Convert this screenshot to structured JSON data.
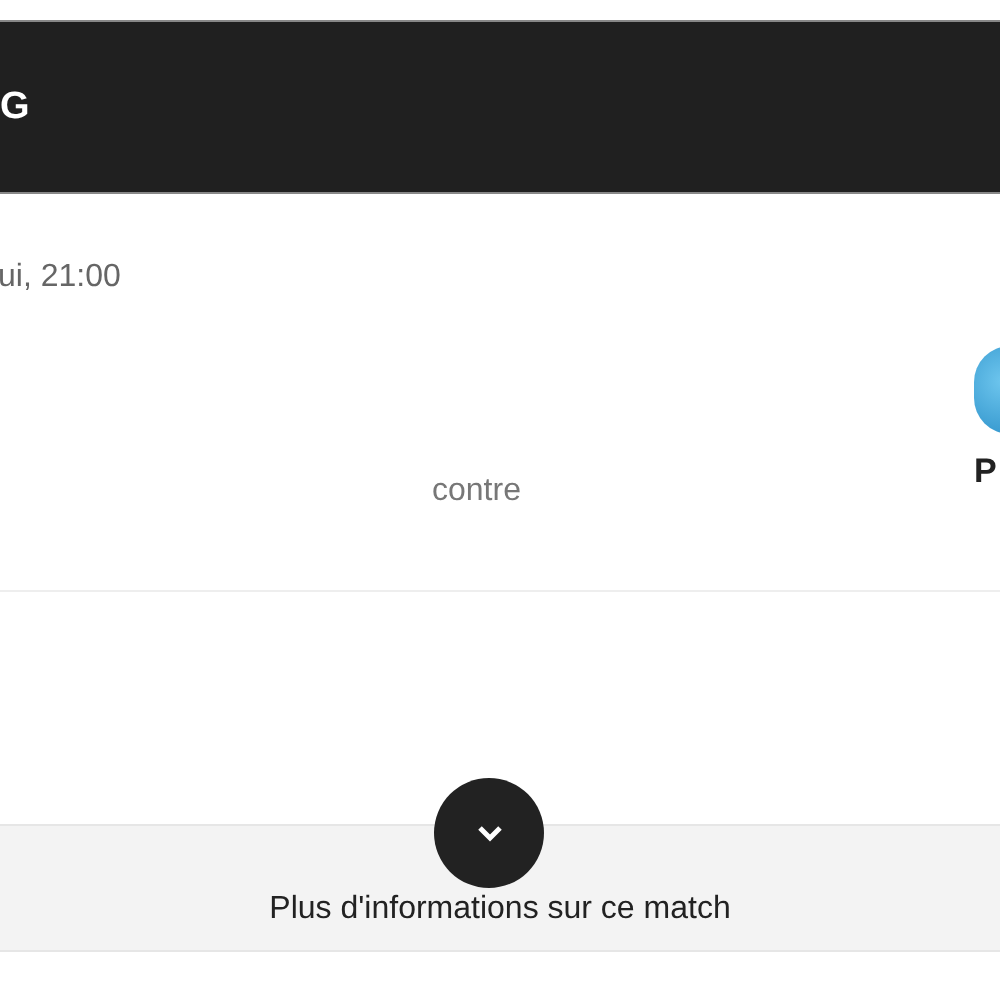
{
  "header": {
    "title": "G"
  },
  "match": {
    "date": "ui, 21:00",
    "versus": "contre",
    "away_team": {
      "name": "P"
    }
  },
  "more_info": {
    "label": "Plus d'informations sur ce match"
  }
}
